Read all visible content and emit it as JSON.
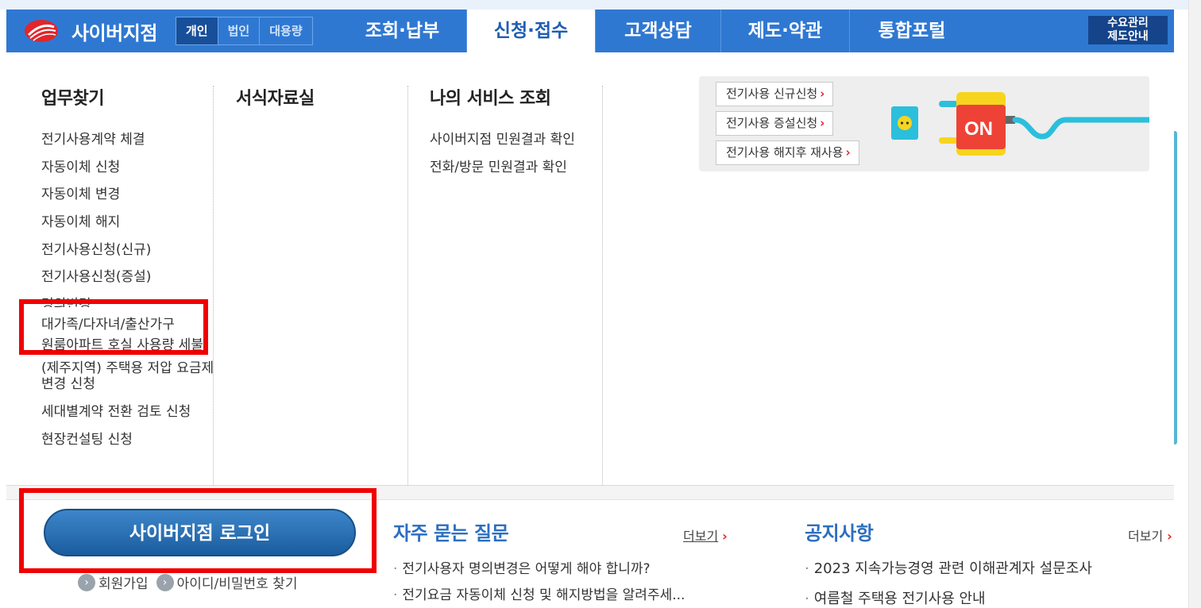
{
  "header": {
    "brand": "사이버지점",
    "segments": [
      "개인",
      "법인",
      "대용량"
    ],
    "active_segment": "개인",
    "nav": [
      "조회·납부",
      "신청·접수",
      "고객상담",
      "제도·약관",
      "통합포털"
    ],
    "active_nav": "신청·접수",
    "demand_line1": "수요관리",
    "demand_line2": "제도안내"
  },
  "menu": {
    "col1": {
      "title": "업무찾기",
      "items": [
        "전기사용계약 체결",
        "자동이체 신청",
        "자동이체 변경",
        "자동이체 해지",
        "전기사용신청(신규)",
        "전기사용신청(증설)",
        "명의변경",
        "대가족/다자녀/출산가구",
        "원룸아파트 호실 사용량 세불",
        "(제주지역) 주택용 저압 요금제 변경 신청",
        "세대별계약 전환 검토 신청",
        "현장컨설팅 신청"
      ]
    },
    "col2": {
      "title": "서식자료실"
    },
    "col3": {
      "title": "나의 서비스 조회",
      "items": [
        "사이버지점 민원결과 확인",
        "전화/방문 민원결과 확인"
      ]
    },
    "promo": {
      "buttons": [
        "전기사용 신규신청",
        "전기사용 증설신청",
        "전기사용 해지후 재사용"
      ],
      "plug_label": "ON"
    }
  },
  "login": {
    "button": "사이버지점 로그인",
    "signup": "회원가입",
    "find": "아이디/비밀번호 찾기"
  },
  "faq": {
    "title": "자주 묻는 질문",
    "more": "더보기",
    "items": [
      "전기사용자 명의변경은 어떻게 해야 합니까?",
      "전기요금 자동이체 신청 및 해지방법을 알려주세..."
    ]
  },
  "notice": {
    "title": "공지사항",
    "more": "더보기",
    "items": [
      "2023 지속가능경영 관련 이해관계자 설문조사",
      "여름철 주택용 전기사용 안내"
    ]
  },
  "colors": {
    "nav_blue": "#2f78d2",
    "highlight_red": "#f00000",
    "section_title": "#2c6fc0",
    "arrow_red": "#e0271f"
  }
}
